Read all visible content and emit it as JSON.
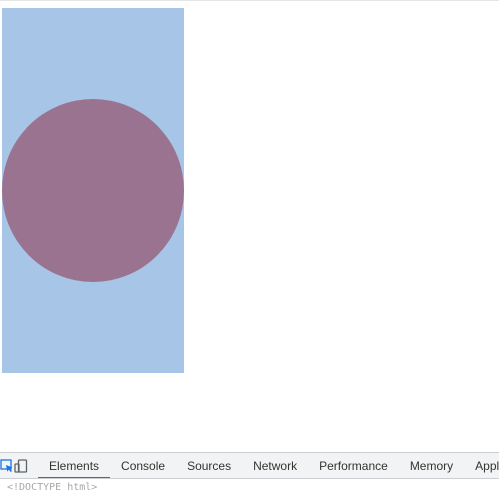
{
  "page": {
    "rect_color": "#a7c6e7",
    "circle_color": "#9a7391"
  },
  "devtools": {
    "icons": [
      "inspect-element-icon",
      "device-toolbar-icon"
    ],
    "tabs": [
      {
        "label": "Elements",
        "active": true
      },
      {
        "label": "Console",
        "active": false
      },
      {
        "label": "Sources",
        "active": false
      },
      {
        "label": "Network",
        "active": false
      },
      {
        "label": "Performance",
        "active": false
      },
      {
        "label": "Memory",
        "active": false
      },
      {
        "label": "Applicat",
        "active": false
      }
    ],
    "accent_color": "#1a73e8",
    "dom_tree": {
      "first_line": "<!DOCTYPE html>"
    }
  }
}
